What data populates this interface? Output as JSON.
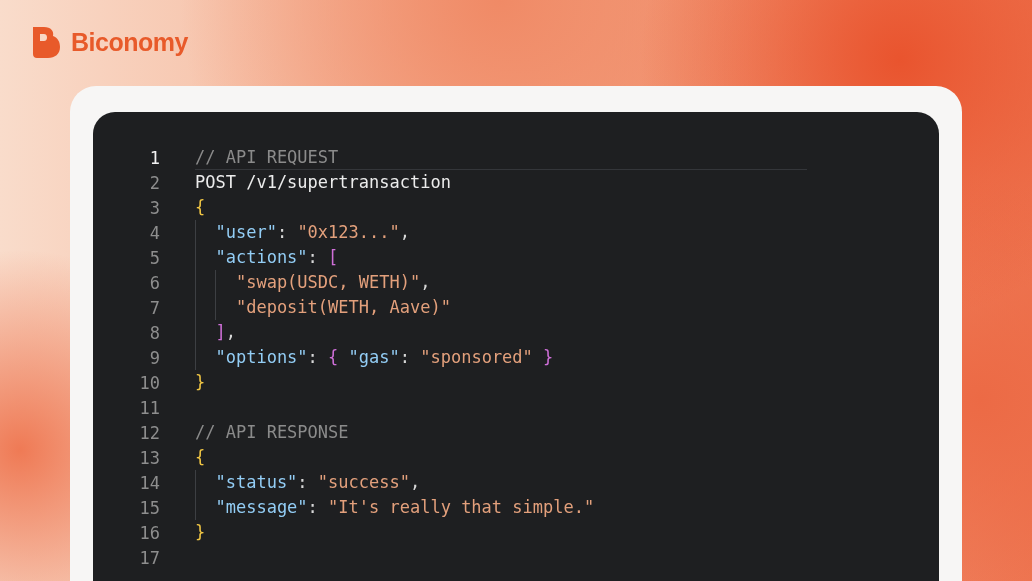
{
  "brand": {
    "name": "Biconomy"
  },
  "editor": {
    "lines": [
      {
        "number": "1",
        "current": true,
        "tokens": [
          {
            "kind": "comment",
            "text": "// API REQUEST"
          }
        ]
      },
      {
        "number": "2",
        "current": false,
        "tokens": [
          {
            "kind": "plain",
            "text": "POST /v1/supertransaction"
          }
        ]
      },
      {
        "number": "3",
        "current": false,
        "tokens": [
          {
            "kind": "brace",
            "text": "{"
          }
        ],
        "children": [
          {
            "number": "4",
            "current": false,
            "tokens": [
              {
                "kind": "key",
                "text": "\"user\""
              },
              {
                "kind": "punct",
                "text": ": "
              },
              {
                "kind": "string",
                "text": "\"0x123...\""
              },
              {
                "kind": "punct",
                "text": ","
              }
            ]
          },
          {
            "number": "5",
            "current": false,
            "tokens": [
              {
                "kind": "key",
                "text": "\"actions\""
              },
              {
                "kind": "punct",
                "text": ": "
              },
              {
                "kind": "bracket",
                "text": "["
              }
            ],
            "children": [
              {
                "number": "6",
                "current": false,
                "tokens": [
                  {
                    "kind": "string",
                    "text": "\"swap(USDC, WETH)\""
                  },
                  {
                    "kind": "punct",
                    "text": ","
                  }
                ]
              },
              {
                "number": "7",
                "current": false,
                "tokens": [
                  {
                    "kind": "string",
                    "text": "\"deposit(WETH, Aave)\""
                  }
                ]
              }
            ]
          },
          {
            "number": "8",
            "current": false,
            "tokens": [
              {
                "kind": "bracket",
                "text": "]"
              },
              {
                "kind": "punct",
                "text": ","
              }
            ]
          },
          {
            "number": "9",
            "current": false,
            "tokens": [
              {
                "kind": "key",
                "text": "\"options\""
              },
              {
                "kind": "punct",
                "text": ": "
              },
              {
                "kind": "bracket",
                "text": "{ "
              },
              {
                "kind": "key",
                "text": "\"gas\""
              },
              {
                "kind": "punct",
                "text": ": "
              },
              {
                "kind": "string",
                "text": "\"sponsored\""
              },
              {
                "kind": "bracket",
                "text": " }"
              }
            ]
          }
        ]
      },
      {
        "number": "10",
        "current": false,
        "tokens": [
          {
            "kind": "brace",
            "text": "}"
          }
        ]
      },
      {
        "number": "11",
        "current": false
      },
      {
        "number": "12",
        "current": false,
        "tokens": [
          {
            "kind": "comment",
            "text": "// API RESPONSE"
          }
        ]
      },
      {
        "number": "13",
        "current": false,
        "tokens": [
          {
            "kind": "brace",
            "text": "{"
          }
        ],
        "children": [
          {
            "number": "14",
            "current": false,
            "tokens": [
              {
                "kind": "key",
                "text": "\"status\""
              },
              {
                "kind": "punct",
                "text": ": "
              },
              {
                "kind": "string",
                "text": "\"success\""
              },
              {
                "kind": "punct",
                "text": ","
              }
            ]
          },
          {
            "number": "15",
            "current": false,
            "tokens": [
              {
                "kind": "key",
                "text": "\"message\""
              },
              {
                "kind": "punct",
                "text": ": "
              },
              {
                "kind": "string",
                "text": "\"It's really that simple.\""
              }
            ]
          }
        ]
      },
      {
        "number": "16",
        "current": false,
        "tokens": [
          {
            "kind": "brace",
            "text": "}"
          }
        ]
      },
      {
        "number": "17",
        "current": false
      }
    ]
  }
}
